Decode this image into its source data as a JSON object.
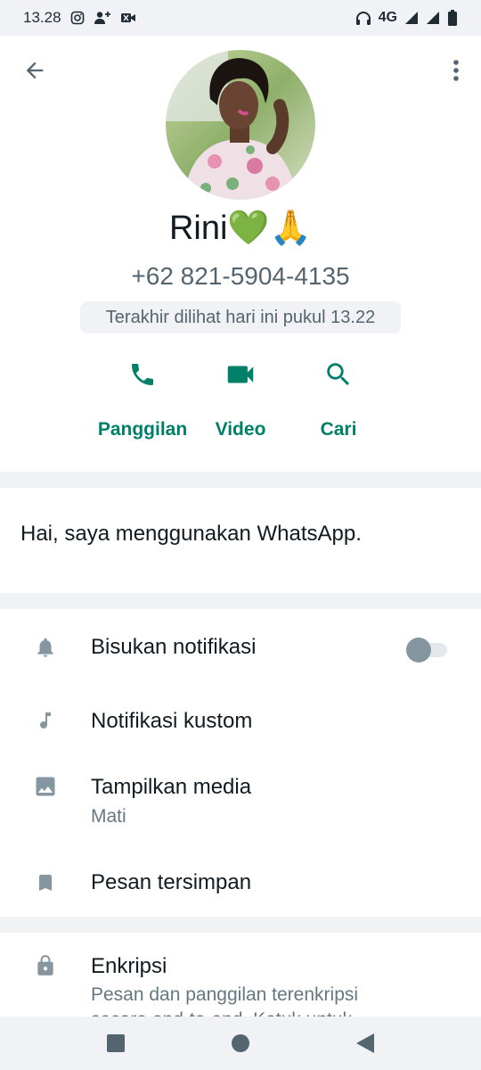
{
  "status_bar": {
    "time": "13.28",
    "network": "4G"
  },
  "contact": {
    "name": "Rini💚🙏",
    "phone": "+62 821-5904-4135",
    "last_seen": "Terakhir dilihat hari ini pukul 13.22"
  },
  "actions": [
    {
      "label": "Panggilan",
      "icon": "phone-icon"
    },
    {
      "label": "Video",
      "icon": "video-icon"
    },
    {
      "label": "Cari",
      "icon": "search-icon"
    }
  ],
  "about": {
    "text": "Hai, saya menggunakan WhatsApp."
  },
  "settings": {
    "mute": {
      "label": "Bisukan notifikasi",
      "enabled": false
    },
    "custom_notifications": {
      "label": "Notifikasi kustom"
    },
    "media_visibility": {
      "label": "Tampilkan media",
      "value": "Mati"
    },
    "saved_messages": {
      "label": "Pesan tersimpan"
    }
  },
  "security": {
    "label": "Enkripsi",
    "description": "Pesan dan panggilan terenkripsi",
    "description_cut": "secara end-to-end. Ketuk untuk"
  },
  "colors": {
    "accent": "#008069",
    "icon_gray": "#8696a0",
    "background": "#f0f2f5"
  }
}
